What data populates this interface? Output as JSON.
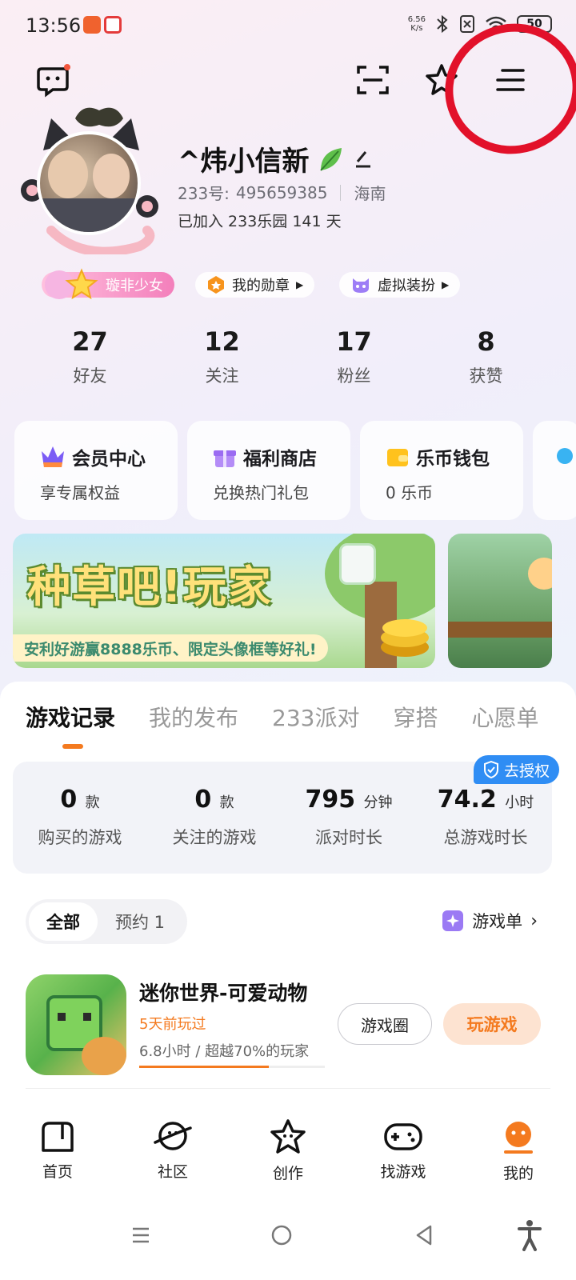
{
  "status_bar": {
    "time": "13:56",
    "net_speed_value": "6.56",
    "net_speed_unit": "K/s",
    "battery": "50"
  },
  "profile": {
    "username": "^炜小信新",
    "id_label": "233号:",
    "id_value": "495659385",
    "location": "海南",
    "joined_text": "已加入 233乐园 141 天"
  },
  "chips": {
    "title_badge": "璇非少女",
    "medals": "我的勋章",
    "costume": "虚拟装扮"
  },
  "stats": [
    {
      "value": "27",
      "label": "好友"
    },
    {
      "value": "12",
      "label": "关注"
    },
    {
      "value": "17",
      "label": "粉丝"
    },
    {
      "value": "8",
      "label": "获赞"
    }
  ],
  "cards": [
    {
      "title": "会员中心",
      "sub": "享专属权益"
    },
    {
      "title": "福利商店",
      "sub": "兑换热门礼包"
    },
    {
      "title": "乐币钱包",
      "sub": "0 乐币"
    }
  ],
  "banner": {
    "title": "种草吧!玩家",
    "subtitle": "安利好游赢8888乐币、限定头像框等好礼!"
  },
  "tabs": [
    "游戏记录",
    "我的发布",
    "233派对",
    "穿搭",
    "心愿单"
  ],
  "auth_badge": "去授权",
  "summary": [
    {
      "value": "0",
      "unit": "款",
      "label": "购买的游戏"
    },
    {
      "value": "0",
      "unit": "款",
      "label": "关注的游戏"
    },
    {
      "value": "795",
      "unit": "分钟",
      "label": "派对时长"
    },
    {
      "value": "74.2",
      "unit": "小时",
      "label": "总游戏时长"
    }
  ],
  "filters": {
    "all": "全部",
    "reserve": "预约 1"
  },
  "playlist": "游戏单",
  "game": {
    "title": "迷你世界-可爱动物",
    "last_played": "5天前玩过",
    "stats": "6.8小时 / 超越70%的玩家",
    "progress": 0.7,
    "circle_btn": "游戏圈",
    "play_btn": "玩游戏"
  },
  "bottom_nav": [
    {
      "label": "首页",
      "icon": "home-icon"
    },
    {
      "label": "社区",
      "icon": "planet-icon"
    },
    {
      "label": "创作",
      "icon": "star-icon"
    },
    {
      "label": "找游戏",
      "icon": "gamepad-icon"
    },
    {
      "label": "我的",
      "icon": "profile-icon"
    }
  ],
  "colors": {
    "accent": "#f47a1f",
    "annotation": "#e2112a",
    "badge_blue": "#2f8df4"
  }
}
